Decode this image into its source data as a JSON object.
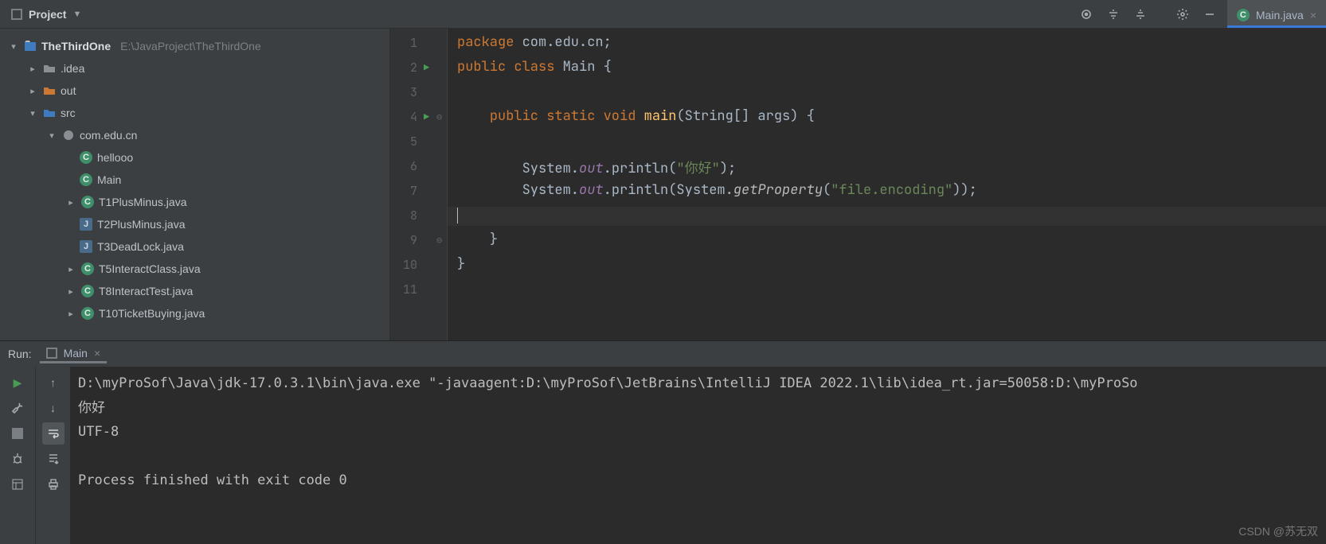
{
  "toolbar": {
    "project_label": "Project",
    "editor_tab": {
      "filename": "Main.java"
    }
  },
  "tree": {
    "root": {
      "name": "TheThirdOne",
      "path": "E:\\JavaProject\\TheThirdOne"
    },
    "idea": ".idea",
    "out": "out",
    "src": "src",
    "pkg": "com.edu.cn",
    "files": {
      "hellooo": "hellooo",
      "main": "Main",
      "t1": "T1PlusMinus.java",
      "t2": "T2PlusMinus.java",
      "t3": "T3DeadLock.java",
      "t5": "T5InteractClass.java",
      "t8": "T8InteractTest.java",
      "t10": "T10TicketBuying.java"
    }
  },
  "code": {
    "l1": {
      "kw1": "package ",
      "id": "com.edu.cn",
      "end": ";"
    },
    "l2": {
      "kw1": "public class ",
      "id": "Main ",
      "br": "{"
    },
    "l4": {
      "ind": "    ",
      "kw": "public static void ",
      "fn": "main",
      "sig": "(String[] args) {"
    },
    "l6": {
      "ind": "        ",
      "sys": "System.",
      "out": "out",
      "pr": ".println(",
      "str": "\"你好\"",
      "end": ");"
    },
    "l7": {
      "ind": "        ",
      "sys": "System.",
      "out": "out",
      "pr": ".println(System.",
      "mi": "getProperty",
      "par": "(",
      "str": "\"file.encoding\"",
      "end": "));"
    },
    "l9": {
      "ind": "    ",
      "br": "}"
    },
    "l10": {
      "br": "}"
    },
    "linenums": [
      "1",
      "2",
      "3",
      "4",
      "5",
      "6",
      "7",
      "8",
      "9",
      "10",
      "11"
    ]
  },
  "run": {
    "label": "Run:",
    "tab": "Main",
    "console": [
      "D:\\myProSof\\Java\\jdk-17.0.3.1\\bin\\java.exe \"-javaagent:D:\\myProSof\\JetBrains\\IntelliJ IDEA 2022.1\\lib\\idea_rt.jar=50058:D:\\myProSo",
      "你好",
      "UTF-8",
      "",
      "Process finished with exit code 0"
    ]
  },
  "watermark": "CSDN @苏无双"
}
